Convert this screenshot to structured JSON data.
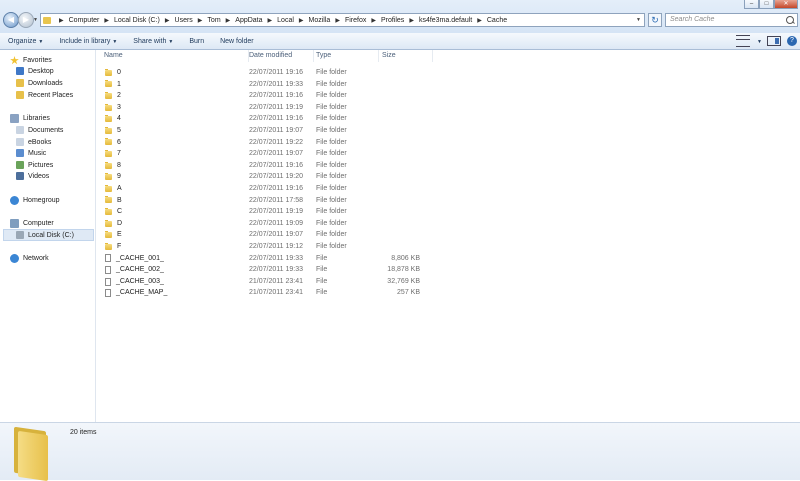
{
  "window": {
    "controls": [
      "–",
      "□",
      "✕"
    ]
  },
  "address": {
    "crumbs": [
      "Computer",
      "Local Disk (C:)",
      "Users",
      "Tom",
      "AppData",
      "Local",
      "Mozilla",
      "Firefox",
      "Profiles",
      "ks4fe3ma.default",
      "Cache"
    ]
  },
  "search": {
    "placeholder": "Search Cache"
  },
  "toolbar": {
    "organize": "Organize",
    "include_in_library": "Include in library",
    "share_with": "Share with",
    "burn": "Burn",
    "new_folder": "New folder",
    "icons": [
      "views-icon",
      "preview-pane-icon",
      "help-icon"
    ]
  },
  "nav": {
    "favorites": {
      "label": "Favorites",
      "items": [
        "Desktop",
        "Downloads",
        "Recent Places"
      ]
    },
    "libraries": {
      "label": "Libraries",
      "items": [
        "Documents",
        "eBooks",
        "Music",
        "Pictures",
        "Videos"
      ]
    },
    "homegroup": "Homegroup",
    "computer": {
      "label": "Computer",
      "items": [
        "Local Disk (C:)"
      ]
    },
    "network": "Network",
    "selected": "Local Disk (C:)"
  },
  "columns": {
    "name": "Name",
    "date": "Date modified",
    "type": "Type",
    "size": "Size"
  },
  "files": [
    {
      "name": "0",
      "date": "22/07/2011 19:16",
      "type": "File folder",
      "size": "",
      "kind": "folder"
    },
    {
      "name": "1",
      "date": "22/07/2011 19:33",
      "type": "File folder",
      "size": "",
      "kind": "folder"
    },
    {
      "name": "2",
      "date": "22/07/2011 19:16",
      "type": "File folder",
      "size": "",
      "kind": "folder"
    },
    {
      "name": "3",
      "date": "22/07/2011 19:19",
      "type": "File folder",
      "size": "",
      "kind": "folder"
    },
    {
      "name": "4",
      "date": "22/07/2011 19:16",
      "type": "File folder",
      "size": "",
      "kind": "folder"
    },
    {
      "name": "5",
      "date": "22/07/2011 19:07",
      "type": "File folder",
      "size": "",
      "kind": "folder"
    },
    {
      "name": "6",
      "date": "22/07/2011 19:22",
      "type": "File folder",
      "size": "",
      "kind": "folder"
    },
    {
      "name": "7",
      "date": "22/07/2011 19:07",
      "type": "File folder",
      "size": "",
      "kind": "folder"
    },
    {
      "name": "8",
      "date": "22/07/2011 19:16",
      "type": "File folder",
      "size": "",
      "kind": "folder"
    },
    {
      "name": "9",
      "date": "22/07/2011 19:20",
      "type": "File folder",
      "size": "",
      "kind": "folder"
    },
    {
      "name": "A",
      "date": "22/07/2011 19:16",
      "type": "File folder",
      "size": "",
      "kind": "folder"
    },
    {
      "name": "B",
      "date": "22/07/2011 17:58",
      "type": "File folder",
      "size": "",
      "kind": "folder"
    },
    {
      "name": "C",
      "date": "22/07/2011 19:19",
      "type": "File folder",
      "size": "",
      "kind": "folder"
    },
    {
      "name": "D",
      "date": "22/07/2011 19:09",
      "type": "File folder",
      "size": "",
      "kind": "folder"
    },
    {
      "name": "E",
      "date": "22/07/2011 19:07",
      "type": "File folder",
      "size": "",
      "kind": "folder"
    },
    {
      "name": "F",
      "date": "22/07/2011 19:12",
      "type": "File folder",
      "size": "",
      "kind": "folder"
    },
    {
      "name": "_CACHE_001_",
      "date": "22/07/2011 19:33",
      "type": "File",
      "size": "8,806 KB",
      "kind": "file"
    },
    {
      "name": "_CACHE_002_",
      "date": "22/07/2011 19:33",
      "type": "File",
      "size": "18,878 KB",
      "kind": "file"
    },
    {
      "name": "_CACHE_003_",
      "date": "21/07/2011 23:41",
      "type": "File",
      "size": "32,769 KB",
      "kind": "file"
    },
    {
      "name": "_CACHE_MAP_",
      "date": "21/07/2011 23:41",
      "type": "File",
      "size": "257 KB",
      "kind": "file"
    }
  ],
  "details": {
    "item_count": "20 items"
  },
  "colors": {
    "folder": "#e7c04a",
    "toolbar_text": "#1e395b",
    "selection": "#dfe9f5"
  }
}
